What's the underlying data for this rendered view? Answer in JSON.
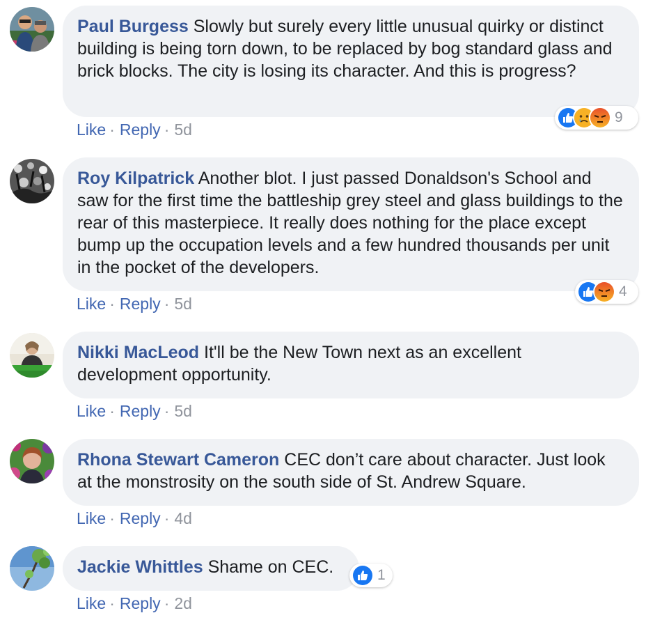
{
  "comments": [
    {
      "author": "Paul Burgess",
      "text": "Slowly but surely every little unusual quirky or distinct building is being torn down, to be replaced by bog standard glass and brick blocks. The city is losing its character. And this is progress?",
      "like": "Like",
      "reply": "Reply",
      "sep": "·",
      "time": "5d",
      "reactions": [
        "like-icon",
        "sad-icon",
        "angry-icon"
      ],
      "reaction_count": "9"
    },
    {
      "author": "Roy Kilpatrick",
      "text": "Another blot. I just passed Donaldson's School and saw for the first time the battleship grey steel and glass buildings to the rear of this masterpiece. It really does nothing for the place except bump up the occupation levels and a few hundred thousands per unit in the pocket of the developers.",
      "like": "Like",
      "reply": "Reply",
      "sep": "·",
      "time": "5d",
      "reactions": [
        "like-icon",
        "angry-icon"
      ],
      "reaction_count": "4"
    },
    {
      "author": "Nikki MacLeod",
      "text": "It'll be the New Town next as an excellent development opportunity.",
      "like": "Like",
      "reply": "Reply",
      "sep": "·",
      "time": "5d"
    },
    {
      "author": "Rhona Stewart Cameron",
      "text": "CEC don’t care about character. Just look at the monstrosity on the south side of St. Andrew Square.",
      "like": "Like",
      "reply": "Reply",
      "sep": "·",
      "time": "4d"
    },
    {
      "author": "Jackie Whittles",
      "text": "Shame on CEC.",
      "like": "Like",
      "reply": "Reply",
      "sep": "·",
      "time": "2d",
      "reactions": [
        "like-icon"
      ],
      "reaction_count": "1"
    }
  ],
  "colors": {
    "author": "#385898",
    "link": "#4267b2",
    "meta": "#90949c",
    "bubble": "#f0f2f5",
    "like": "#1877f2",
    "angry": "#e9710f",
    "sad": "#f7b125"
  }
}
